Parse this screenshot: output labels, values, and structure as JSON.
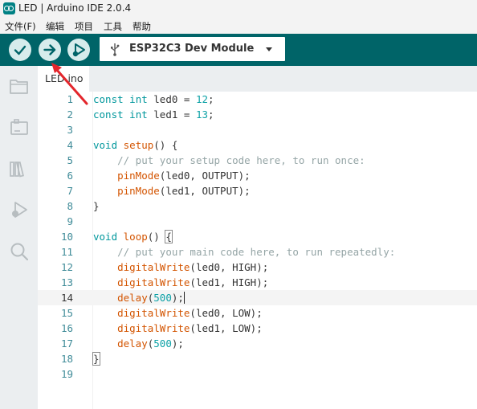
{
  "window": {
    "title": "LED | Arduino IDE 2.0.4"
  },
  "menu": [
    "文件(F)",
    "编辑",
    "项目",
    "工具",
    "帮助"
  ],
  "toolbar": {
    "verify_icon": "check-icon",
    "upload_icon": "arrow-right-icon",
    "debug_icon": "debug-play-icon",
    "board": "ESP32C3 Dev Module",
    "accent": "#006468"
  },
  "sidebar": {
    "items": [
      "folder-icon",
      "board-manager-icon",
      "library-icon",
      "debug-icon",
      "search-icon"
    ]
  },
  "tabs": [
    {
      "label": "LED.ino",
      "active": true
    }
  ],
  "editor": {
    "current_line": 14,
    "lines": [
      {
        "n": "1",
        "text": "const int led0 = 12;"
      },
      {
        "n": "2",
        "text": "const int led1 = 13;"
      },
      {
        "n": "3",
        "text": ""
      },
      {
        "n": "4",
        "text": "void setup() {"
      },
      {
        "n": "5",
        "text": "    // put your setup code here, to run once:"
      },
      {
        "n": "6",
        "text": "    pinMode(led0, OUTPUT);"
      },
      {
        "n": "7",
        "text": "    pinMode(led1, OUTPUT);"
      },
      {
        "n": "8",
        "text": "}"
      },
      {
        "n": "9",
        "text": ""
      },
      {
        "n": "10",
        "text": "void loop() {"
      },
      {
        "n": "11",
        "text": "    // put your main code here, to run repeatedly:"
      },
      {
        "n": "12",
        "text": "    digitalWrite(led0, HIGH);"
      },
      {
        "n": "13",
        "text": "    digitalWrite(led1, HIGH);"
      },
      {
        "n": "14",
        "text": "    delay(500);"
      },
      {
        "n": "15",
        "text": "    digitalWrite(led0, LOW);"
      },
      {
        "n": "16",
        "text": "    digitalWrite(led1, LOW);"
      },
      {
        "n": "17",
        "text": "    delay(500);"
      },
      {
        "n": "18",
        "text": "}"
      },
      {
        "n": "19",
        "text": ""
      }
    ]
  }
}
